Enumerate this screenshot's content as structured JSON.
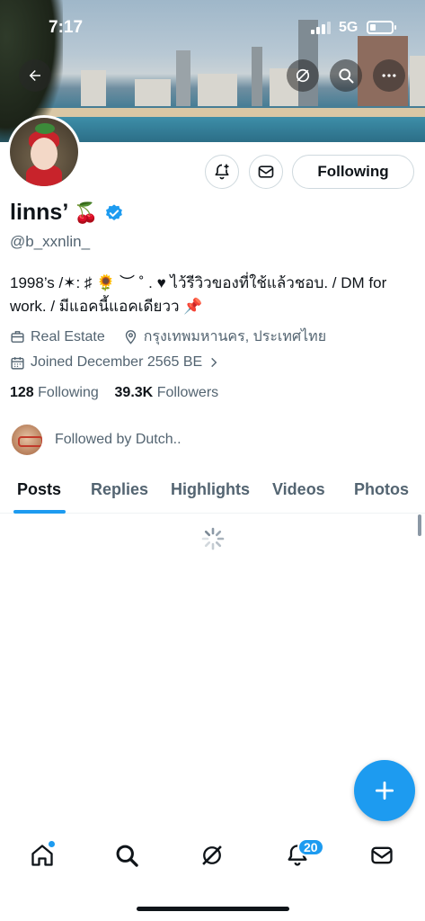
{
  "status_bar": {
    "time": "7:17",
    "network": "5G"
  },
  "profile": {
    "name": "linns’",
    "name_emoji": "🍒",
    "handle": "@b_xxnlin_",
    "bio_line1": "1998’s /✶: ♯ 🌻 ︶ ˚ . ♥ ไว้รีวิวของที่ใช้แล้วชอบ. / DM for",
    "bio_line2": "work. / มีแอคนี้แอคเดียวว 📌",
    "category": "Real Estate",
    "location": "กรุงเทพมหานคร, ประเทศไทย",
    "joined": "Joined December 2565 BE",
    "following_count": "128",
    "following_label": "Following",
    "followers_count": "39.3K",
    "followers_label": "Followers",
    "followed_by": "Followed by Dutch.."
  },
  "actions": {
    "follow_label": "Following"
  },
  "tabs": [
    {
      "label": "Posts"
    },
    {
      "label": "Replies"
    },
    {
      "label": "Highlights"
    },
    {
      "label": "Videos"
    },
    {
      "label": "Photos"
    }
  ],
  "nav": {
    "notifications_badge": "20"
  },
  "colors": {
    "accent": "#1d9bf0",
    "text": "#0f1419",
    "secondary": "#536471"
  }
}
